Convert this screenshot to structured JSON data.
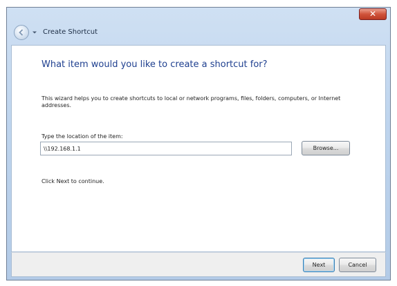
{
  "window": {
    "close_label": "✕"
  },
  "nav": {
    "title": "Create Shortcut"
  },
  "main": {
    "heading": "What item would you like to create a shortcut for?",
    "description": "This wizard helps you to create shortcuts to local or network programs, files, folders, computers, or Internet addresses.",
    "location_label": "Type the location of the item:",
    "location_value": "\\\\192.168.1.1",
    "browse_label": "Browse...",
    "continue_text": "Click Next to continue."
  },
  "footer": {
    "next_label": "Next",
    "cancel_label": "Cancel"
  },
  "colors": {
    "heading": "#1e3f8f",
    "close_button": "#c84a33",
    "frame": "#bfd5ee"
  }
}
